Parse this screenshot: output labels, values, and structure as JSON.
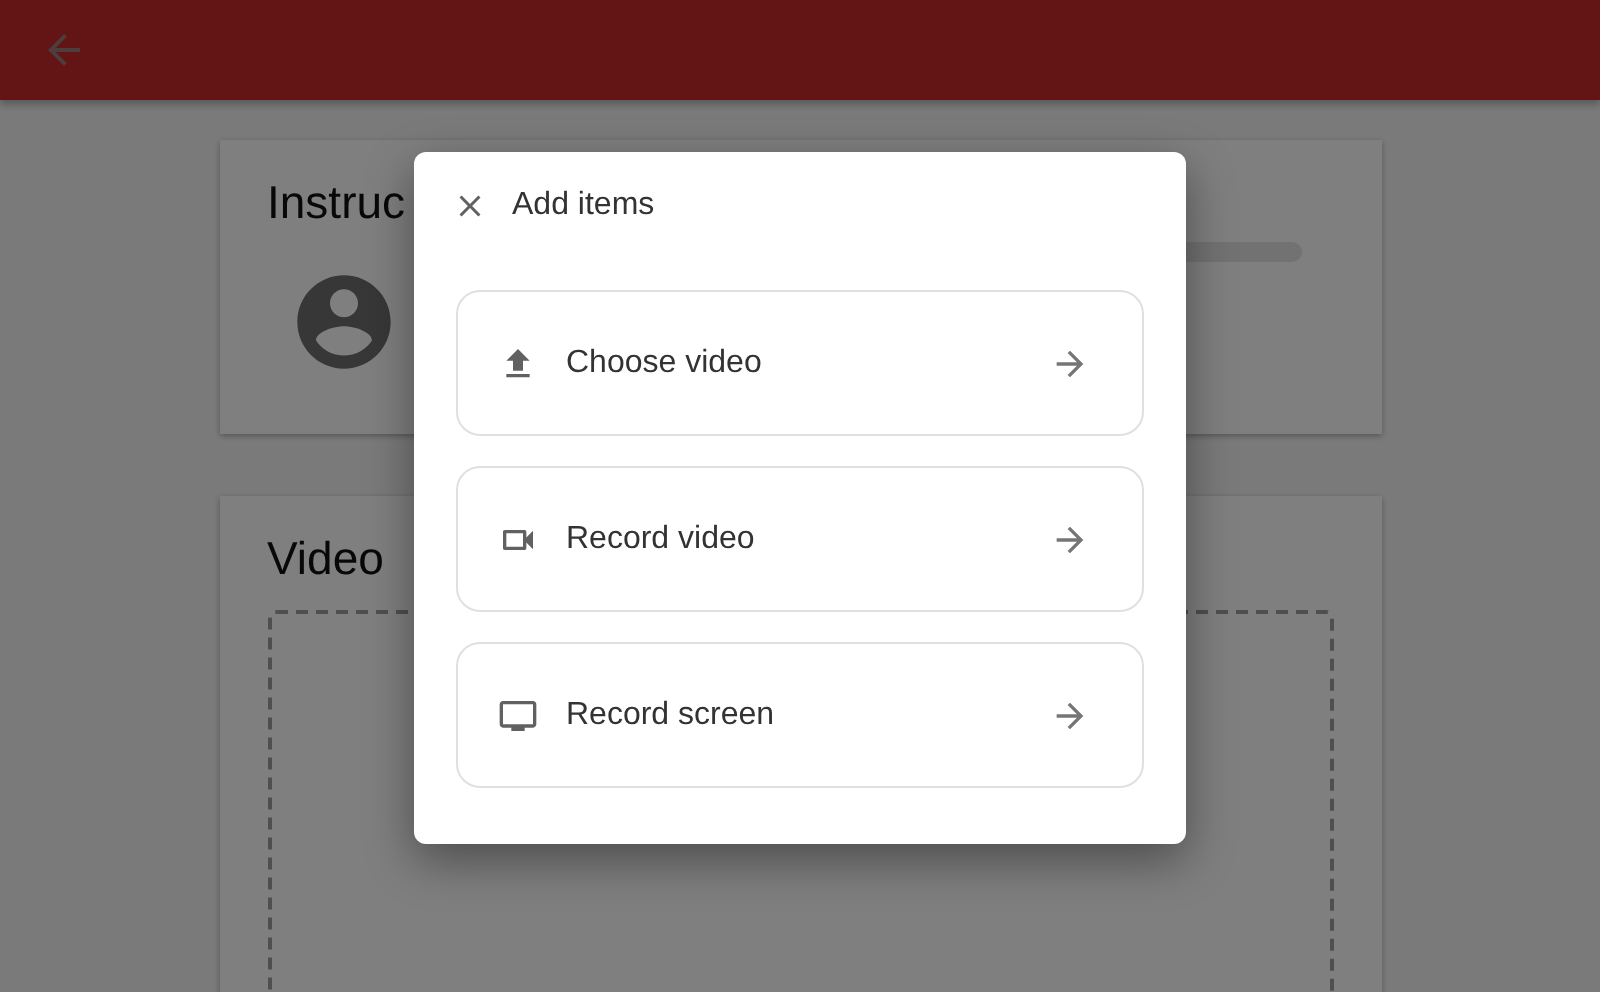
{
  "page": {
    "cards": [
      {
        "kind": "profile",
        "title": "Instruc"
      },
      {
        "kind": "dropzone",
        "title": "Video"
      }
    ]
  },
  "dialog": {
    "title": "Add items",
    "options": [
      {
        "kind": "upload",
        "label": "Choose video"
      },
      {
        "kind": "camera",
        "label": "Record video"
      },
      {
        "kind": "screen",
        "label": "Record screen"
      }
    ]
  }
}
